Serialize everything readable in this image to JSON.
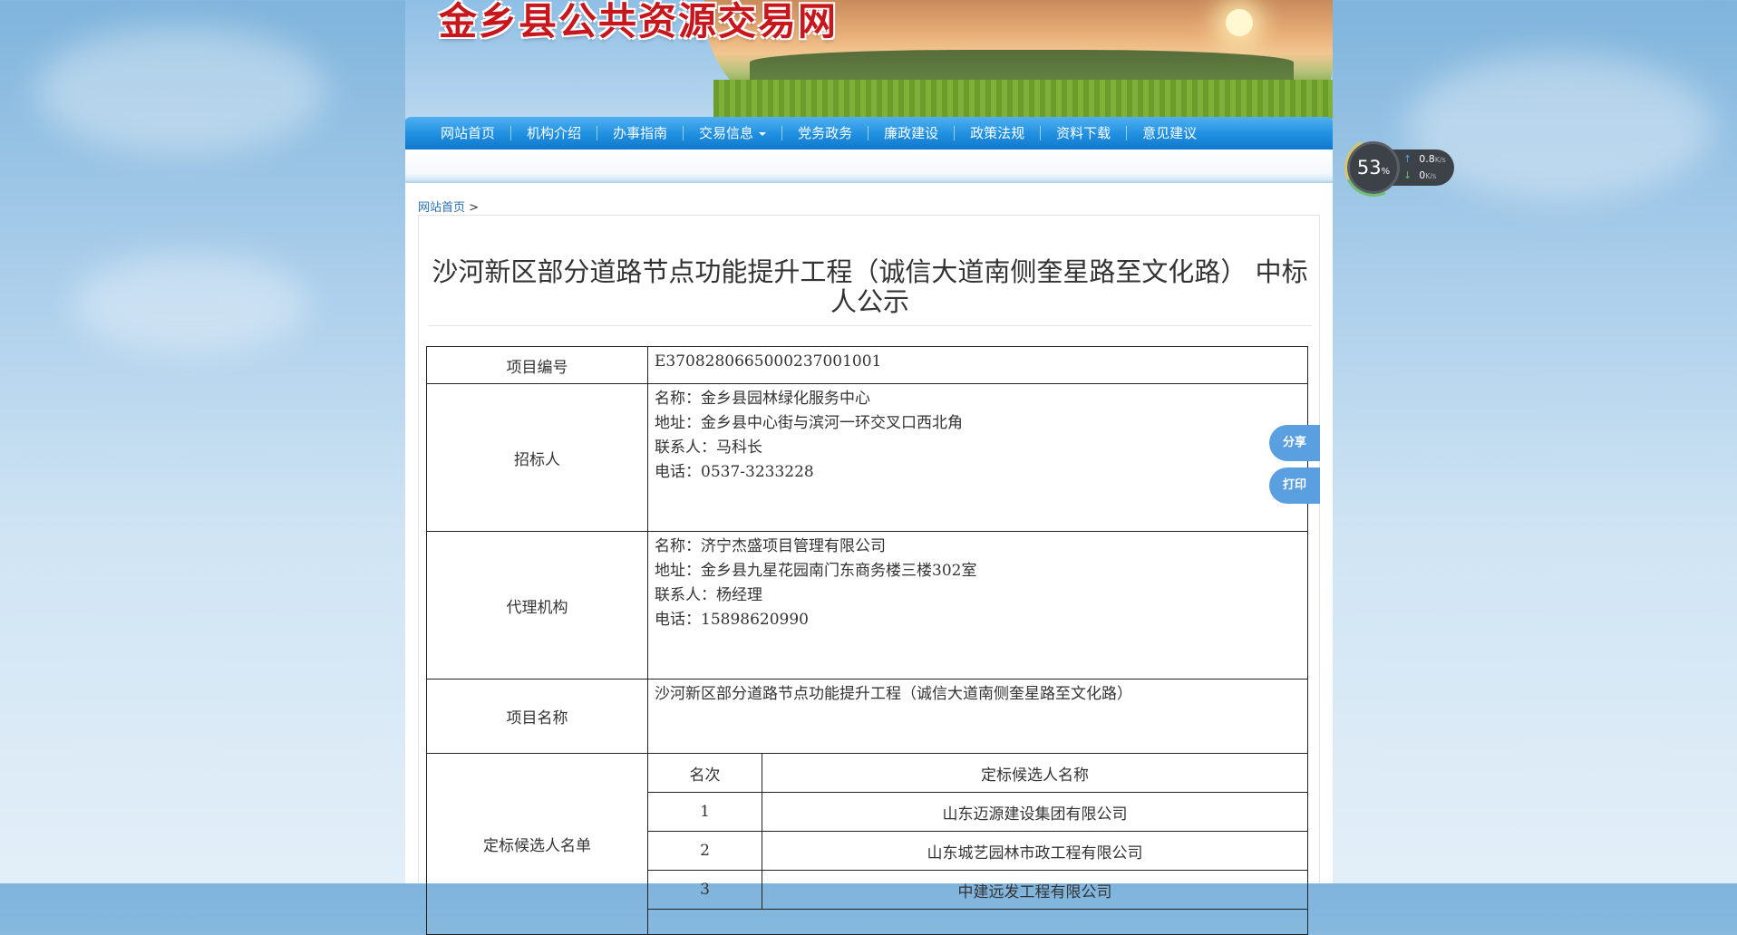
{
  "site": {
    "title": "金乡县公共资源交易网"
  },
  "nav": {
    "items": [
      {
        "label": "网站首页",
        "has_dropdown": false
      },
      {
        "label": "机构介绍",
        "has_dropdown": false
      },
      {
        "label": "办事指南",
        "has_dropdown": false
      },
      {
        "label": "交易信息",
        "has_dropdown": true
      },
      {
        "label": "党务政务",
        "has_dropdown": false
      },
      {
        "label": "廉政建设",
        "has_dropdown": false
      },
      {
        "label": "政策法规",
        "has_dropdown": false
      },
      {
        "label": "资料下载",
        "has_dropdown": false
      },
      {
        "label": "意见建议",
        "has_dropdown": false
      }
    ]
  },
  "breadcrumb": {
    "home": "网站首页",
    "separator": ">"
  },
  "article": {
    "title": "沙河新区部分道路节点功能提升工程（诚信大道南侧奎星路至文化路） 中标人公示"
  },
  "info_table": {
    "project_code": {
      "label": "项目编号",
      "value": "E3708280665000237001001"
    },
    "tenderer": {
      "label": "招标人",
      "name": "名称：金乡县园林绿化服务中心",
      "address": "地址：金乡县中心街与滨河一环交叉口西北角",
      "contact": "联系人：马科长",
      "phone": "电话：0537-3233228"
    },
    "agency": {
      "label": "代理机构",
      "name": "名称：济宁杰盛项目管理有限公司",
      "address": "地址：金乡县九星花园南门东商务楼三楼302室",
      "contact": "联系人：杨经理",
      "phone": "电话：15898620990"
    },
    "project_name": {
      "label": "项目名称",
      "value": "沙河新区部分道路节点功能提升工程（诚信大道南侧奎星路至文化路）"
    },
    "candidates": {
      "label": "定标候选人名单",
      "header_rank": "名次",
      "header_name": "定标候选人名称",
      "rows": [
        {
          "rank": "1",
          "name": "山东迈源建设集团有限公司"
        },
        {
          "rank": "2",
          "name": "山东城艺园林市政工程有限公司"
        },
        {
          "rank": "3",
          "name": "中建远发工程有限公司"
        }
      ]
    }
  },
  "widgets": {
    "cpu_percent": "53",
    "cpu_unit": "%",
    "upload": "0.8",
    "download": "0",
    "rate_unit": "K/s",
    "share_label": "分享",
    "print_label": "打印"
  },
  "colors": {
    "nav_blue": "#1f8fe0",
    "title_red": "#c8161d",
    "side_button_blue": "#5aa0e0"
  }
}
